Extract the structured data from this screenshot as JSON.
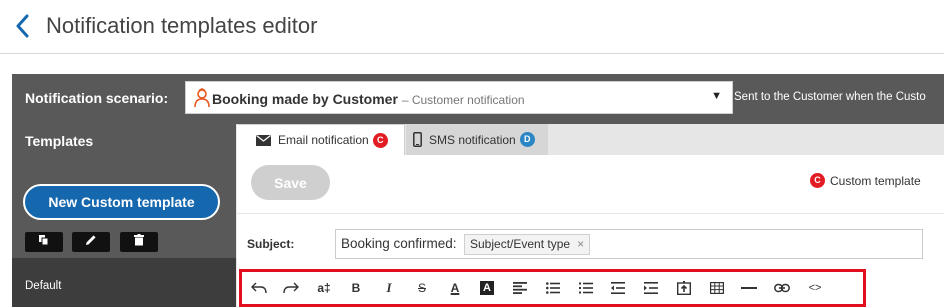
{
  "header": {
    "title": "Notification templates editor"
  },
  "scenario": {
    "label": "Notification scenario:",
    "name": "Booking made by Customer",
    "subtitle": "– Customer notification",
    "description": "Sent to the Customer when the Custo",
    "arrow": "▼"
  },
  "sidebar": {
    "title": "Templates",
    "new_button": "New Custom template",
    "default_item": "Default"
  },
  "tabs": [
    {
      "label": "Email notification",
      "badge": "C"
    },
    {
      "label": "SMS notification",
      "badge": "D"
    }
  ],
  "editor": {
    "save_label": "Save",
    "custom_badge": "C",
    "custom_label": "Custom template",
    "subject_label": "Subject:",
    "subject_text": "Booking confirmed:",
    "subject_tag": "Subject/Event type",
    "tag_close": "×"
  },
  "toolbar": {
    "font_size_label": "a‡",
    "bold_label": "B",
    "italic_label": "I",
    "strike_label": "S",
    "text_color_label": "A",
    "bg_color_label": "A",
    "code_label": "<>"
  },
  "colors": {
    "accent": "#1567ae",
    "badge_custom": "#e31b23",
    "badge_default": "#2b86c5",
    "highlight": "#e2101e",
    "dark_panel": "#595959"
  }
}
